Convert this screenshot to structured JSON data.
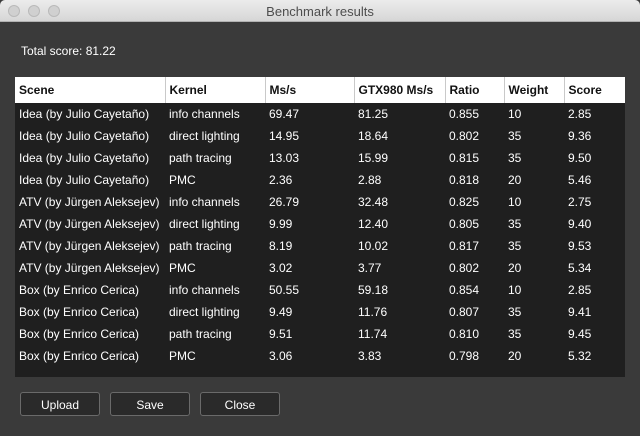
{
  "window": {
    "title": "Benchmark results"
  },
  "summary": {
    "total_score": "Total score: 81.22"
  },
  "table": {
    "columns": [
      "Scene",
      "Kernel",
      "Ms/s",
      "GTX980 Ms/s",
      "Ratio",
      "Weight",
      "Score"
    ],
    "rows": [
      [
        "Idea (by Julio Cayetaño)",
        "info channels",
        "69.47",
        "81.25",
        "0.855",
        "10",
        "2.85"
      ],
      [
        "Idea (by Julio Cayetaño)",
        "direct lighting",
        "14.95",
        "18.64",
        "0.802",
        "35",
        "9.36"
      ],
      [
        "Idea (by Julio Cayetaño)",
        "path tracing",
        "13.03",
        "15.99",
        "0.815",
        "35",
        "9.50"
      ],
      [
        "Idea (by Julio Cayetaño)",
        "PMC",
        "2.36",
        "2.88",
        "0.818",
        "20",
        "5.46"
      ],
      [
        "ATV (by Jürgen Aleksejev)",
        "info channels",
        "26.79",
        "32.48",
        "0.825",
        "10",
        "2.75"
      ],
      [
        "ATV (by Jürgen Aleksejev)",
        "direct lighting",
        "9.99",
        "12.40",
        "0.805",
        "35",
        "9.40"
      ],
      [
        "ATV (by Jürgen Aleksejev)",
        "path tracing",
        "8.19",
        "10.02",
        "0.817",
        "35",
        "9.53"
      ],
      [
        "ATV (by Jürgen Aleksejev)",
        "PMC",
        "3.02",
        "3.77",
        "0.802",
        "20",
        "5.34"
      ],
      [
        "Box (by Enrico Cerica)",
        "info channels",
        "50.55",
        "59.18",
        "0.854",
        "10",
        "2.85"
      ],
      [
        "Box (by Enrico Cerica)",
        "direct lighting",
        "9.49",
        "11.76",
        "0.807",
        "35",
        "9.41"
      ],
      [
        "Box (by Enrico Cerica)",
        "path tracing",
        "9.51",
        "11.74",
        "0.810",
        "35",
        "9.45"
      ],
      [
        "Box (by Enrico Cerica)",
        "PMC",
        "3.06",
        "3.83",
        "0.798",
        "20",
        "5.32"
      ]
    ]
  },
  "buttons": {
    "upload": "Upload",
    "save": "Save",
    "close": "Close"
  }
}
